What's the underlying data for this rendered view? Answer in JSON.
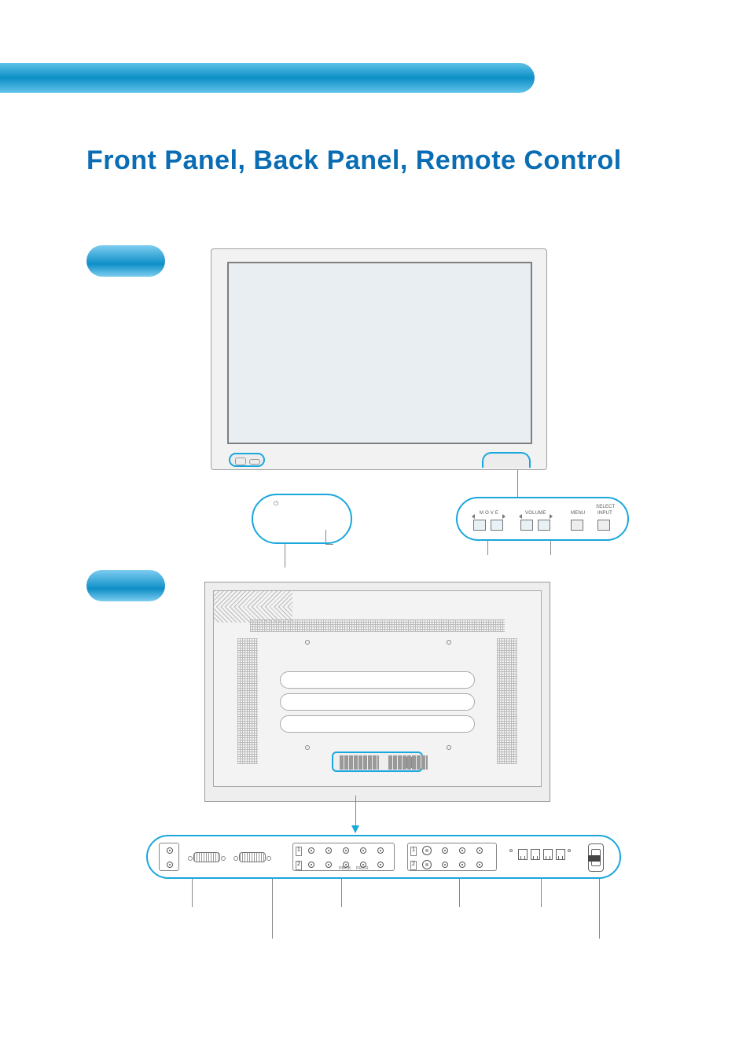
{
  "title": "Front Panel, Back Panel, Remote Control",
  "front": {
    "power_symbol": "⏻",
    "controls": {
      "move_label": "M O V E",
      "volume_label": "VOLUME",
      "menu_label": "MENU",
      "select_input_label_1": "SELECT",
      "select_input_label_2": "INPUT"
    }
  },
  "back": {
    "ports": {
      "group_video_num1": "1",
      "group_video_num2": "2",
      "group_svideo_num1": "1",
      "group_svideo_num2": "2",
      "pb": "PB/CB",
      "pr": "PR/CR"
    }
  }
}
